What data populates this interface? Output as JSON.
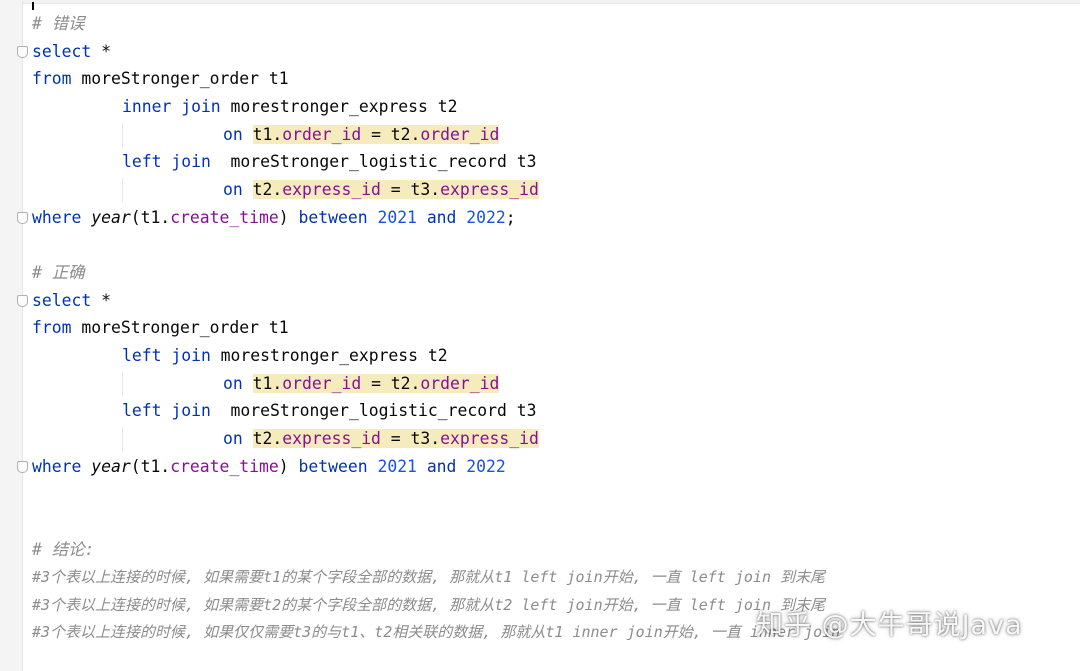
{
  "editor": {
    "block1": {
      "comment": "# 错误",
      "select_kw": "select",
      "star": " *",
      "from_kw": "from",
      "from_table": " moreStronger_order t1",
      "join1_kw": "inner join",
      "join1_table": " morestronger_express t2",
      "on1_kw": "on",
      "on1_t1": "t1",
      "on1_field1": "order_id",
      "on1_eq": " = t2.",
      "on1_field2": "order_id",
      "join2_kw": "left join",
      "join2_table": "  moreStronger_logistic_record t3",
      "on2_kw": "on",
      "on2_t": "t2",
      "on2_field1": "express_id",
      "on2_eq": " = t3.",
      "on2_field2": "express_id",
      "where_kw": "where",
      "where_fn": "year",
      "where_arg": "(t1.",
      "where_field": "create_time",
      "where_close": ")",
      "between_kw": "between",
      "num1": "2021",
      "and_kw": "and",
      "num2": "2022",
      "semi": ";"
    },
    "block2": {
      "comment": "# 正确",
      "select_kw": "select",
      "star": " *",
      "from_kw": "from",
      "from_table": " moreStronger_order t1",
      "join1_kw": "left join",
      "join1_table": " morestronger_express t2",
      "on1_kw": "on",
      "on1_t1": "t1",
      "on1_field1": "order_id",
      "on1_eq": " = t2.",
      "on1_field2": "order_id",
      "join2_kw": "left join",
      "join2_table": "  moreStronger_logistic_record t3",
      "on2_kw": "on",
      "on2_t": "t2",
      "on2_field1": "express_id",
      "on2_eq": " = t3.",
      "on2_field2": "express_id",
      "where_kw": "where",
      "where_fn": "year",
      "where_arg": "(t1.",
      "where_field": "create_time",
      "where_close": ")",
      "between_kw": "between",
      "num1": "2021",
      "and_kw": "and",
      "num2": "2022"
    },
    "conclusion": {
      "heading": "# 结论:",
      "line1": "#3个表以上连接的时候, 如果需要t1的某个字段全部的数据, 那就从t1 left join开始, 一直 left join 到末尾",
      "line2": "#3个表以上连接的时候, 如果需要t2的某个字段全部的数据, 那就从t2 left join开始, 一直 left join 到末尾",
      "line3": "#3个表以上连接的时候, 如果仅仅需要t3的与t1、t2相关联的数据, 那就从t1 inner join开始, 一直 inner join"
    }
  },
  "watermark": "知乎 @大牛哥说Java"
}
